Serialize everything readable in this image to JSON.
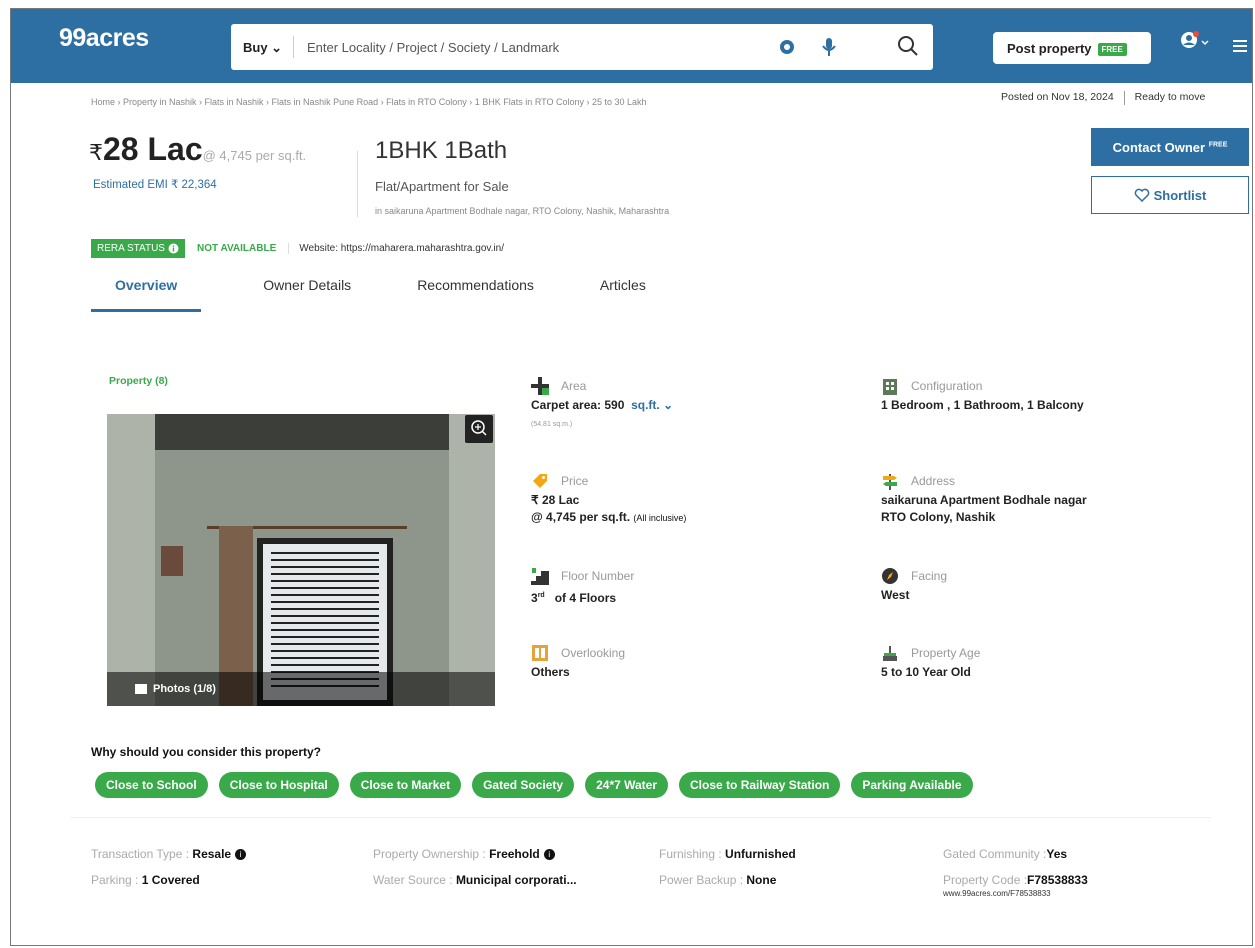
{
  "header": {
    "logo": "99acres",
    "buy_label": "Buy",
    "search_placeholder": "Enter Locality / Project / Society / Landmark",
    "post_property": "Post property",
    "free_tag": "FREE"
  },
  "breadcrumb": "Home › Property in Nashik › Flats in Nashik › Flats in Nashik Pune Road › Flats in RTO Colony › 1 BHK Flats in RTO Colony › 25 to 30 Lakh",
  "posted": {
    "date": "Posted on Nov 18, 2024",
    "status": "Ready to move"
  },
  "listing": {
    "currency": "₹",
    "price": "28 Lac",
    "per_sqft": "@ 4,745 per sq.ft.",
    "emi": "Estimated EMI ₹ 22,364",
    "title": "1BHK 1Bath",
    "subtitle": "Flat/Apartment for Sale",
    "address_line": "in saikaruna Apartment Bodhale nagar, RTO Colony, Nashik, Maharashtra"
  },
  "actions": {
    "contact": "Contact Owner",
    "contact_tag": "FREE",
    "shortlist": "Shortlist"
  },
  "rera": {
    "status_label": "RERA STATUS",
    "status_value": "NOT AVAILABLE",
    "website": "Website: https://maharera.maharashtra.gov.in/"
  },
  "tabs": [
    "Overview",
    "Owner Details",
    "Recommendations",
    "Articles"
  ],
  "gallery": {
    "count_label": "Property (8)",
    "photos_label": "Photos (1/8)"
  },
  "attributes": {
    "area": {
      "label": "Area",
      "value": "Carpet area: 590",
      "unit": "sq.ft.",
      "note": "(54.81 sq.m.)"
    },
    "configuration": {
      "label": "Configuration",
      "value": "1 Bedroom , 1 Bathroom, 1 Balcony"
    },
    "price": {
      "label": "Price",
      "value1": "₹ 28 Lac",
      "value2": "@ 4,745 per sq.ft.",
      "note": "(All inclusive)"
    },
    "address": {
      "label": "Address",
      "value1": "saikaruna Apartment Bodhale nagar",
      "value2": "RTO Colony, Nashik"
    },
    "floor": {
      "label": "Floor Number",
      "value": "3",
      "sup": "rd",
      "suffix": "of 4 Floors"
    },
    "facing": {
      "label": "Facing",
      "value": "West"
    },
    "overlooking": {
      "label": "Overlooking",
      "value": "Others"
    },
    "age": {
      "label": "Property Age",
      "value": "5 to 10 Year Old"
    }
  },
  "why": {
    "heading": "Why should you consider this property?",
    "chips": [
      "Close to School",
      "Close to Hospital",
      "Close to Market",
      "Gated Society",
      "24*7 Water",
      "Close to Railway Station",
      "Parking Available"
    ]
  },
  "details": {
    "transaction": {
      "label": "Transaction Type :",
      "value": "Resale"
    },
    "parking": {
      "label": "Parking :",
      "value": "1 Covered"
    },
    "ownership": {
      "label": "Property Ownership :",
      "value": "Freehold"
    },
    "water": {
      "label": "Water Source :",
      "value": "Municipal corporati..."
    },
    "furnishing": {
      "label": "Furnishing :",
      "value": "Unfurnished"
    },
    "backup": {
      "label": "Power Backup :",
      "value": "None"
    },
    "gated": {
      "label": "Gated Community :",
      "value": "Yes"
    },
    "code": {
      "label": "Property Code :",
      "value": "F78538833",
      "url": "www.99acres.com/F78538833"
    }
  },
  "colors": {
    "brand_blue": "#2e6fa3",
    "green": "#39a94a"
  }
}
